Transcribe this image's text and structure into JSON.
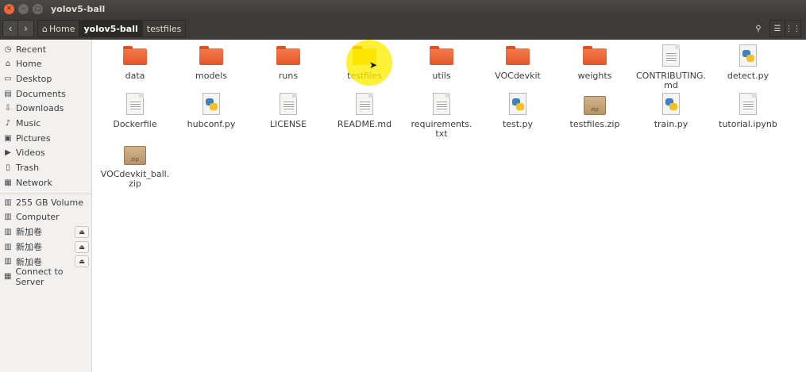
{
  "window": {
    "title": "yolov5-ball"
  },
  "toolbar": {
    "back_label": "‹",
    "forward_label": "›",
    "breadcrumbs": [
      "Home",
      "yolov5-ball",
      "testfiles"
    ],
    "search_label": "⚲",
    "list_view_label": "☰",
    "grid_view_label": "⋮⋮"
  },
  "sidebar": {
    "places": [
      {
        "label": "Recent",
        "icon": "clock-icon"
      },
      {
        "label": "Home",
        "icon": "home-icon"
      },
      {
        "label": "Desktop",
        "icon": "desktop-icon"
      },
      {
        "label": "Documents",
        "icon": "documents-icon"
      },
      {
        "label": "Downloads",
        "icon": "downloads-icon"
      },
      {
        "label": "Music",
        "icon": "music-icon"
      },
      {
        "label": "Pictures",
        "icon": "pictures-icon"
      },
      {
        "label": "Videos",
        "icon": "videos-icon"
      },
      {
        "label": "Trash",
        "icon": "trash-icon"
      },
      {
        "label": "Network",
        "icon": "network-icon"
      }
    ],
    "devices": [
      {
        "label": "255 GB Volume",
        "icon": "drive-icon",
        "eject": false
      },
      {
        "label": "Computer",
        "icon": "computer-icon",
        "eject": false
      },
      {
        "label": "新加卷",
        "icon": "drive-icon",
        "eject": true
      },
      {
        "label": "新加卷",
        "icon": "drive-icon",
        "eject": true
      },
      {
        "label": "新加卷",
        "icon": "drive-icon",
        "eject": true
      },
      {
        "label": "Connect to Server",
        "icon": "server-icon",
        "eject": false
      }
    ]
  },
  "files": [
    {
      "name": "data",
      "type": "folder"
    },
    {
      "name": "models",
      "type": "folder"
    },
    {
      "name": "runs",
      "type": "folder"
    },
    {
      "name": "testfiles",
      "type": "folder"
    },
    {
      "name": "utils",
      "type": "folder"
    },
    {
      "name": "VOCdevkit",
      "type": "folder"
    },
    {
      "name": "weights",
      "type": "folder"
    },
    {
      "name": "CONTRIBUTING.\nmd",
      "type": "document"
    },
    {
      "name": "detect.py",
      "type": "python"
    },
    {
      "name": "Dockerfile",
      "type": "document"
    },
    {
      "name": "hubconf.py",
      "type": "python"
    },
    {
      "name": "LICENSE",
      "type": "document"
    },
    {
      "name": "README.md",
      "type": "document"
    },
    {
      "name": "requirements.\ntxt",
      "type": "document"
    },
    {
      "name": "test.py",
      "type": "python"
    },
    {
      "name": "testfiles.zip",
      "type": "zip"
    },
    {
      "name": "train.py",
      "type": "python"
    },
    {
      "name": "tutorial.ipynb",
      "type": "document"
    },
    {
      "name": "VOCdevkit_ball.\nzip",
      "type": "zip"
    }
  ],
  "zip_badge": "zip",
  "colors": {
    "folder": "#e4562a",
    "titlebar": "#3c3b37",
    "highlight": "#ffec00",
    "close_button": "#f0683a"
  }
}
